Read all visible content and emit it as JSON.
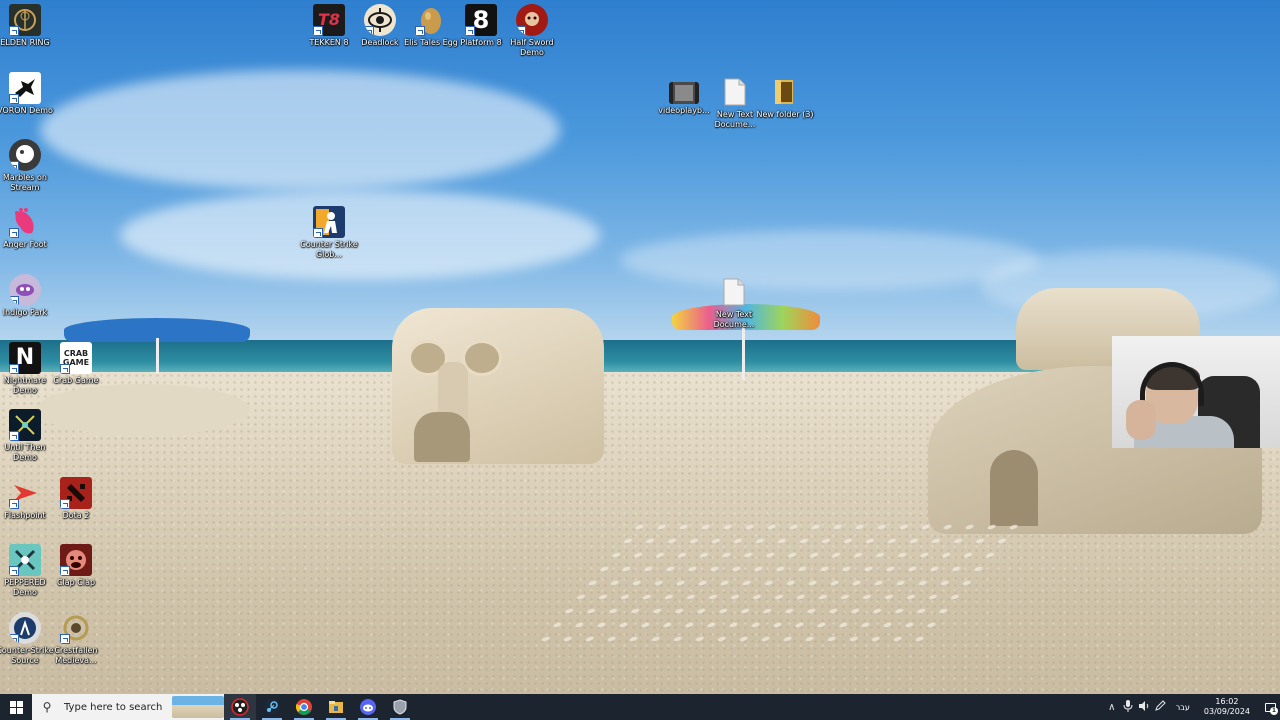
{
  "desktop": {
    "icons": {
      "elden_ring": {
        "label": "ELDEN RING",
        "icon": "elden-ring-game-icon",
        "glyph": "",
        "bg": "#27302a",
        "fg": "#c9a15a"
      },
      "voron": {
        "label": "VORON Demo",
        "icon": "raven-icon",
        "glyph": "✈",
        "bg": "#ffffff",
        "fg": "#111111"
      },
      "marbles": {
        "label": "Marbles on Stream",
        "icon": "marbles-icon",
        "glyph": "●",
        "bg": "#3a3a3a",
        "fg": "#ffffff"
      },
      "anger_foot": {
        "label": "Anger Foot",
        "icon": "foot-icon",
        "glyph": "❀",
        "bg": "transparent",
        "fg": "#e83a7c"
      },
      "indigo_park": {
        "label": "Indigo Park",
        "icon": "indigo-park-icon",
        "glyph": "◕",
        "bg": "#c7b9d9",
        "fg": "#8e4fb8"
      },
      "nightmare": {
        "label": "Nightmare Demo",
        "icon": "letter-n-icon",
        "glyph": "N",
        "bg": "#111111",
        "fg": "#ffffff"
      },
      "crab_game": {
        "label": "Crab Game",
        "icon": "crab-game-icon",
        "glyph": "CRAB GAME",
        "bg": "#ffffff",
        "fg": "#222222"
      },
      "until_then": {
        "label": "Until Then Demo",
        "icon": "until-then-icon",
        "glyph": "✧",
        "bg": "#0d1c2b",
        "fg": "#d7d24c"
      },
      "flashpoint": {
        "label": "Flashpoint",
        "icon": "flashpoint-icon",
        "glyph": "➤",
        "bg": "transparent",
        "fg": "#e23a32"
      },
      "dota2": {
        "label": "Dota 2",
        "icon": "dota2-icon",
        "glyph": "✖",
        "bg": "#a8221b",
        "fg": "#1a0b08"
      },
      "peppered": {
        "label": "PEPPERED Demo",
        "icon": "peppered-icon",
        "glyph": "✶",
        "bg": "#6ac7c0",
        "fg": "#1e3640"
      },
      "clap_clap": {
        "label": "Clap Clap",
        "icon": "clap-clap-face-icon",
        "glyph": "☻",
        "bg": "#6e1a16",
        "fg": "#e58a7a"
      },
      "counter_strike_source": {
        "label": "Counter-Strike Source",
        "icon": "counter-strike-source-icon",
        "glyph": "☻",
        "bg": "#dcdcdc",
        "fg": "#1c3c6b"
      },
      "crestfallen": {
        "label": "Crestfallen Medieva...",
        "icon": "crestfallen-crest-icon",
        "glyph": "❂",
        "bg": "transparent",
        "fg": "#b59b54"
      },
      "tekken8": {
        "label": "TEKKEN 8",
        "icon": "tekken8-icon",
        "glyph": "T8",
        "bg": "#1b1b1b",
        "fg": "#e2324a"
      },
      "deadlock": {
        "label": "Deadlock",
        "icon": "deadlock-eye-icon",
        "glyph": "◉",
        "bg": "#efe6d1",
        "fg": "#1b1b1b"
      },
      "elis_tales_egg": {
        "label": "Elis Tales Egg",
        "icon": "egg-icon",
        "glyph": "⬮",
        "bg": "transparent",
        "fg": "#c99b4b"
      },
      "platform8": {
        "label": "Platform 8",
        "icon": "platform8-icon",
        "glyph": "8",
        "bg": "#111111",
        "fg": "#ffffff"
      },
      "half_sword": {
        "label": "Half Sword Demo",
        "icon": "half-sword-icon",
        "glyph": "☠",
        "bg": "#a11a14",
        "fg": "#e8c59f"
      },
      "counter_strike_global": {
        "label": "Counter Strike Glob...",
        "icon": "counter-strike-global-icon",
        "glyph": "☻",
        "bg": "#1e3b6d",
        "fg": "#f2a92b"
      },
      "videoplayback": {
        "label": "videoplayb...",
        "icon": "video-file-icon",
        "glyph": "▶",
        "bg": "#4a4a4a",
        "fg": "#dddddd"
      },
      "new_text_doc_1": {
        "label": "New Text Docume...",
        "icon": "text-document-icon",
        "glyph": "",
        "bg": "#f4f4f4",
        "fg": "#999999"
      },
      "new_folder_3": {
        "label": "New folder (3)",
        "icon": "folder-icon",
        "glyph": "",
        "bg": "#e1b64a",
        "fg": "#6a4a12"
      },
      "new_text_doc_2": {
        "label": "New Text Docume...",
        "icon": "text-document-icon",
        "glyph": "",
        "bg": "#f4f4f4",
        "fg": "#999999"
      }
    }
  },
  "taskbar": {
    "start_icon": "windows-start-icon",
    "search_placeholder": "Type here to search",
    "pinned": [
      {
        "name": "obs-studio-icon",
        "color": "#202020",
        "ring": "#e3262d"
      },
      {
        "name": "steam-icon",
        "color": "#1b2838",
        "ring": "#66c0f4"
      },
      {
        "name": "chrome-icon",
        "color": "#db4437",
        "ring": "#f4c20d"
      },
      {
        "name": "file-explorer-icon",
        "color": "#e8b94a",
        "ring": "#f6dd8c"
      },
      {
        "name": "discord-icon",
        "color": "#5865f2",
        "ring": "#ffffff"
      },
      {
        "name": "app-shield-icon",
        "color": "#9aa3ad",
        "ring": "#dfe3e7"
      }
    ],
    "tray": {
      "chevron_icon": "∧",
      "mic_icon": "🎙",
      "volume_icon": "🔈",
      "pen_icon": "✎",
      "language": "עבר",
      "time": "16:02",
      "date": "03/09/2024",
      "notification_count": "1"
    }
  },
  "webcam": {
    "label": "streamer-webcam-overlay"
  }
}
